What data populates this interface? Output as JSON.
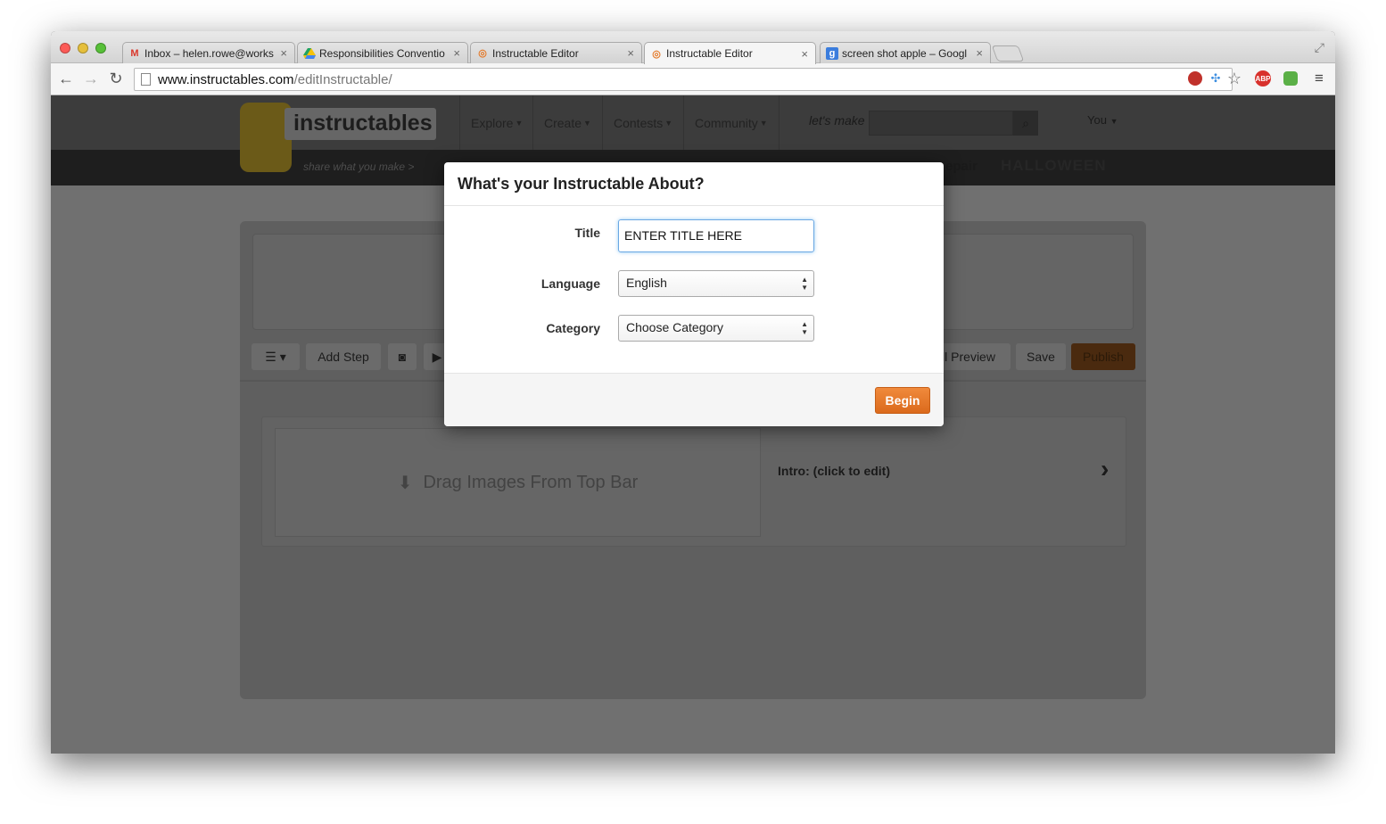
{
  "browser": {
    "tabs": [
      {
        "title": "Inbox – helen.rowe@works",
        "favicon": "gmail-icon"
      },
      {
        "title": "Responsibilities Conventio",
        "favicon": "drive-icon"
      },
      {
        "title": "Instructable Editor",
        "favicon": "instructables-icon"
      },
      {
        "title": "Instructable Editor",
        "favicon": "instructables-icon"
      },
      {
        "title": "screen shot apple – Googl",
        "favicon": "google-icon"
      }
    ],
    "active_tab_index": 3,
    "url": {
      "host": "www.instructables.com",
      "path": "/editInstructable/"
    },
    "extensions": {
      "abp_label": "ABP"
    }
  },
  "site": {
    "logo": "instructables",
    "tagline": "share what you make >",
    "nav": [
      {
        "label": "Explore"
      },
      {
        "label": "Create"
      },
      {
        "label": "Contests"
      },
      {
        "label": "Community"
      }
    ],
    "search_prompt": "let's make",
    "user_label": "You",
    "subnav": {
      "repair": "epair",
      "halloween": "HALLOWEEN"
    }
  },
  "editor": {
    "toolbar": {
      "add_step": "Add Step",
      "preview": "ll Preview",
      "save": "Save",
      "publish": "Publish"
    },
    "step": {
      "drag_text": "Drag Images From Top Bar",
      "intro_text": "Intro: (click to edit)"
    }
  },
  "modal": {
    "title": "What's your Instructable About?",
    "fields": {
      "title_label": "Title",
      "title_value": "ENTER TITLE HERE",
      "language_label": "Language",
      "language_value": "English",
      "category_label": "Category",
      "category_value": "Choose Category"
    },
    "begin_label": "Begin",
    "begin_color": "#e47a2a"
  }
}
